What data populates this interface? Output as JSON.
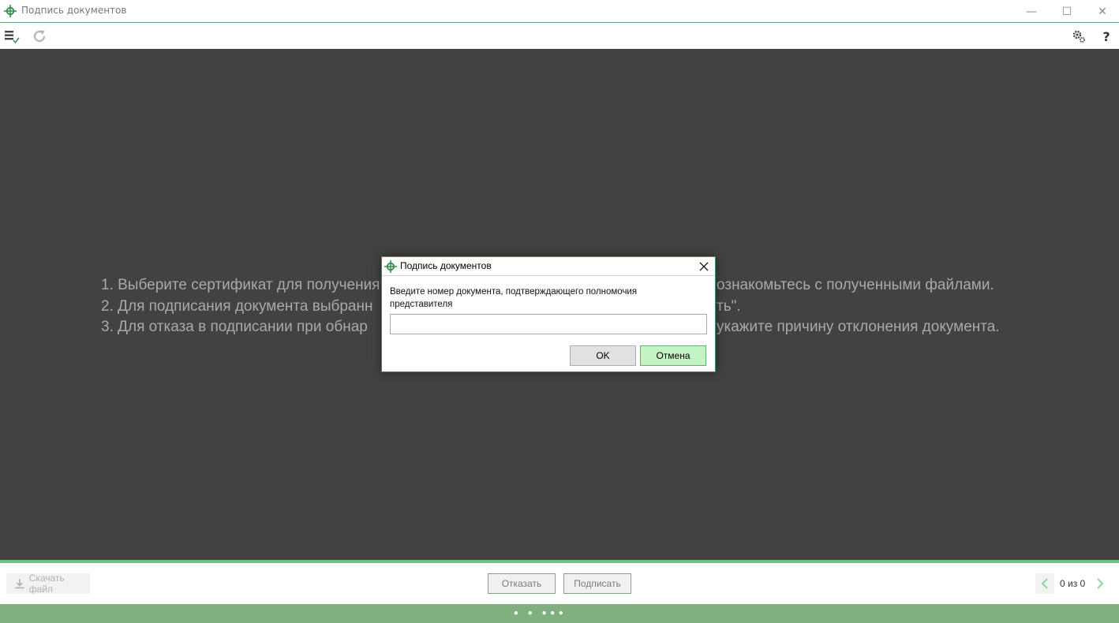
{
  "window": {
    "title": "Подпись документов",
    "accent_color": "#3e8f53",
    "min_symbol": "—",
    "max_symbol": "☐",
    "close_symbol": "✕"
  },
  "toolbar": {
    "help_label": "?"
  },
  "content": {
    "lines": [
      "1. Выберите сертификат для получения",
      "2. Для подписания документа выбранн",
      "3. Для отказа в подписании при обнар"
    ],
    "lines_right": [
      "ознакомьтесь с полученными файлами.",
      "ть\".",
      "укажите причину отклонения документа."
    ]
  },
  "dialog": {
    "title": "Подпись документов",
    "prompt": "Введите номер документа, подтверждающего полномочия представителя",
    "input_value": "",
    "ok_label": "OK",
    "cancel_label": "Отмена"
  },
  "bottom": {
    "download_label": "Скачать файл",
    "reject_label": "Отказать",
    "sign_label": "Подписать",
    "pager_text": "0 из 0"
  },
  "status": {
    "dots": "• • •••"
  }
}
